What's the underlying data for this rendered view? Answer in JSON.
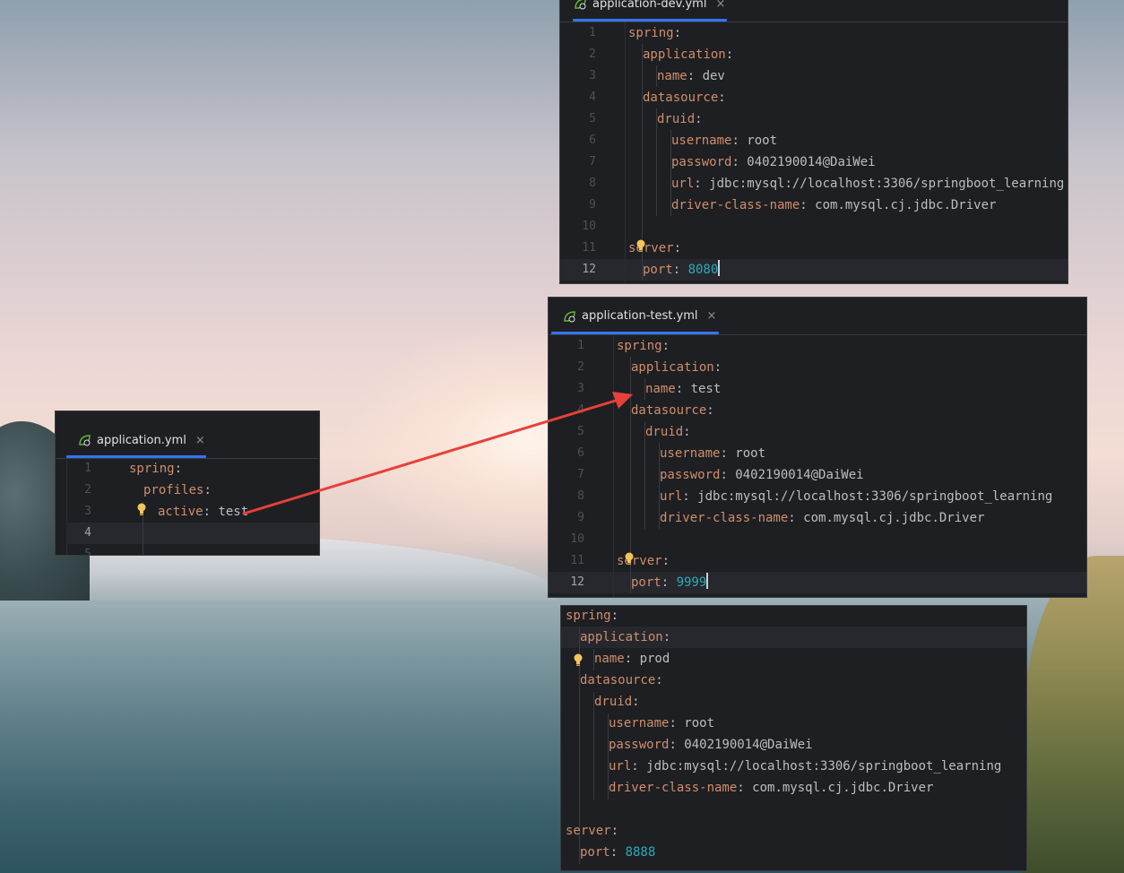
{
  "colors": {
    "key": "#cf8e6d",
    "number": "#2aacb8",
    "text": "#bcbec4",
    "editor_bg": "#1e1f22",
    "tab_underline": "#3574f0",
    "arrow": "#e8403a"
  },
  "dev": {
    "tab": {
      "label": "application-dev.yml",
      "icon": "spring-leaf-icon",
      "close": "×"
    },
    "lines": [
      "1",
      "2",
      "3",
      "4",
      "5",
      "6",
      "7",
      "8",
      "9",
      "10",
      "11",
      "12"
    ],
    "spring": "spring",
    "application": "application",
    "name_key": "name",
    "name_val": "dev",
    "datasource": "datasource",
    "druid": "druid",
    "username_key": "username",
    "username_val": "root",
    "password_key": "password",
    "password_val": "0402190014@DaiWei",
    "url_key": "url",
    "url_val": "jdbc:mysql://localhost:3306/springboot_learning",
    "driver_key": "driver-class-name",
    "driver_val": "com.mysql.cj.jdbc.Driver",
    "server": "server",
    "port_key": "port",
    "port_val": "8080"
  },
  "test": {
    "tab": {
      "label": "application-test.yml",
      "icon": "spring-leaf-icon",
      "close": "×"
    },
    "lines": [
      "1",
      "2",
      "3",
      "4",
      "5",
      "6",
      "7",
      "8",
      "9",
      "10",
      "11",
      "12"
    ],
    "spring": "spring",
    "application": "application",
    "name_key": "name",
    "name_val": "test",
    "datasource": "datasource",
    "druid": "druid",
    "username_key": "username",
    "username_val": "root",
    "password_key": "password",
    "password_val": "0402190014@DaiWei",
    "url_key": "url",
    "url_val": "jdbc:mysql://localhost:3306/springboot_learning",
    "driver_key": "driver-class-name",
    "driver_val": "com.mysql.cj.jdbc.Driver",
    "server": "server",
    "port_key": "port",
    "port_val": "9999"
  },
  "main": {
    "tab": {
      "label": "application.yml",
      "icon": "spring-leaf-icon",
      "close": "×"
    },
    "lines": [
      "1",
      "2",
      "3",
      "4",
      "5"
    ],
    "spring": "spring",
    "profiles": "profiles",
    "active_key": "active",
    "active_val": "test"
  },
  "prod": {
    "spring": "spring",
    "application": "application",
    "name_key": "name",
    "name_val": "prod",
    "datasource": "datasource",
    "druid": "druid",
    "username_key": "username",
    "username_val": "root",
    "password_key": "password",
    "password_val": "0402190014@DaiWei",
    "url_key": "url",
    "url_val": "jdbc:mysql://localhost:3306/springboot_learning",
    "driver_key": "driver-class-name",
    "driver_val": "com.mysql.cj.jdbc.Driver",
    "server": "server",
    "port_key": "port",
    "port_val": "8888"
  }
}
